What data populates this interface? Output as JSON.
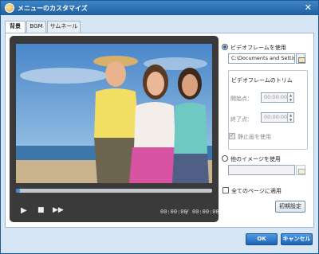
{
  "window": {
    "title": "メニューのカスタマイズ",
    "close_label": "✕"
  },
  "tabs": [
    {
      "label": "背景"
    },
    {
      "label": "BGM"
    },
    {
      "label": "サムネール"
    }
  ],
  "player": {
    "progress_fraction": 0.02,
    "current_time": "00:00:00",
    "separator": "/",
    "total_time": "00:00:00"
  },
  "options": {
    "use_video_frame_label": "ビデオフレームを使用",
    "video_path": "C:\\Documents and Settings\\",
    "trim_group_label": "ビデオフレームのトリム",
    "start_label": "開始点：",
    "start_value": "00:00:00",
    "end_label": "終了点：",
    "end_value": "00:00:00",
    "use_still_label": "静止画を使用",
    "use_other_image_label": "他のイメージを使用",
    "other_image_path": "",
    "apply_all_pages_label": "全てのページに適用",
    "reset_label": "初期設定"
  },
  "footer": {
    "ok_label": "OK",
    "cancel_label": "キャンセル"
  },
  "colors": {
    "accent": "#1f64b5",
    "titlebar": "#2b6fb1",
    "background": "#d7e6f4"
  }
}
